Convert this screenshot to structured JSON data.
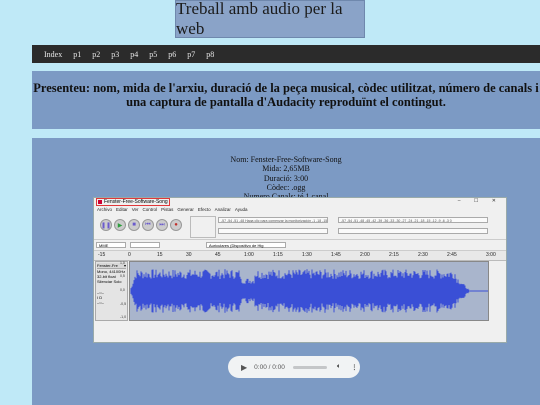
{
  "header": {
    "title": "Treball amb audio per la web"
  },
  "nav": {
    "items": [
      "Index",
      "p1",
      "p2",
      "p3",
      "p4",
      "p5",
      "p6",
      "p7",
      "p8"
    ]
  },
  "present": {
    "line1": "Presenteu: nom, mida de l'arxiu, duració de la peça musical, còdec utilitzat, número de canals i",
    "line2": "una captura de pantalla d'Audacity reproduïnt el contingut."
  },
  "info": {
    "nom": "Nom: Fenster-Free-Software-Song",
    "mida": "Mida: 2,65MB",
    "duracio": "Duració: 3:00",
    "codec": "Còdec: .ogg",
    "canals": "Numero Canals: té 1 canal"
  },
  "audacity": {
    "window_title": "Fenster-Free-Software-Song",
    "window_controls": "–   ☐   ✕",
    "menu": [
      "Archivo",
      "Editar",
      "Ver",
      "Control",
      "Pistas",
      "Generar",
      "Efecto",
      "Analizar",
      "Ayuda"
    ],
    "meter_rec": "-57 -54 -51 -48  Haga clic para comenzar la monitorización -1 -18 -15 -12 -9 -6 -3 0",
    "meter_play": "-57 -54 -51 -48 -45 -42 -39 -36 -33 -30 -27 -24 -21 -18 -15 -12 -9 -6 -3 0",
    "host": "MME",
    "output_device": "Auriculares (Dispositivo de Hig",
    "timeline_ticks": [
      "-15",
      "0",
      "15",
      "30",
      "45",
      "1:00",
      "1:15",
      "1:30",
      "1:45",
      "2:00",
      "2:15",
      "2:30",
      "2:45",
      "3:00"
    ],
    "track_name": "Fenster-Fre",
    "track_info": [
      "Mono, 44100Hz",
      "32-bit float",
      "Silenciar   Solo"
    ],
    "track_lr": "I      D",
    "scale": [
      "1,0",
      "0,5",
      "0,0",
      "-0,5",
      "-1,0"
    ]
  },
  "player": {
    "time": "0:00 / 0:00"
  },
  "colors": {
    "page_bg": "#bfe9f7",
    "panel": "#7c9ac4",
    "nav_bg": "#2b2b2b",
    "waveform": "#3a4fd6"
  }
}
